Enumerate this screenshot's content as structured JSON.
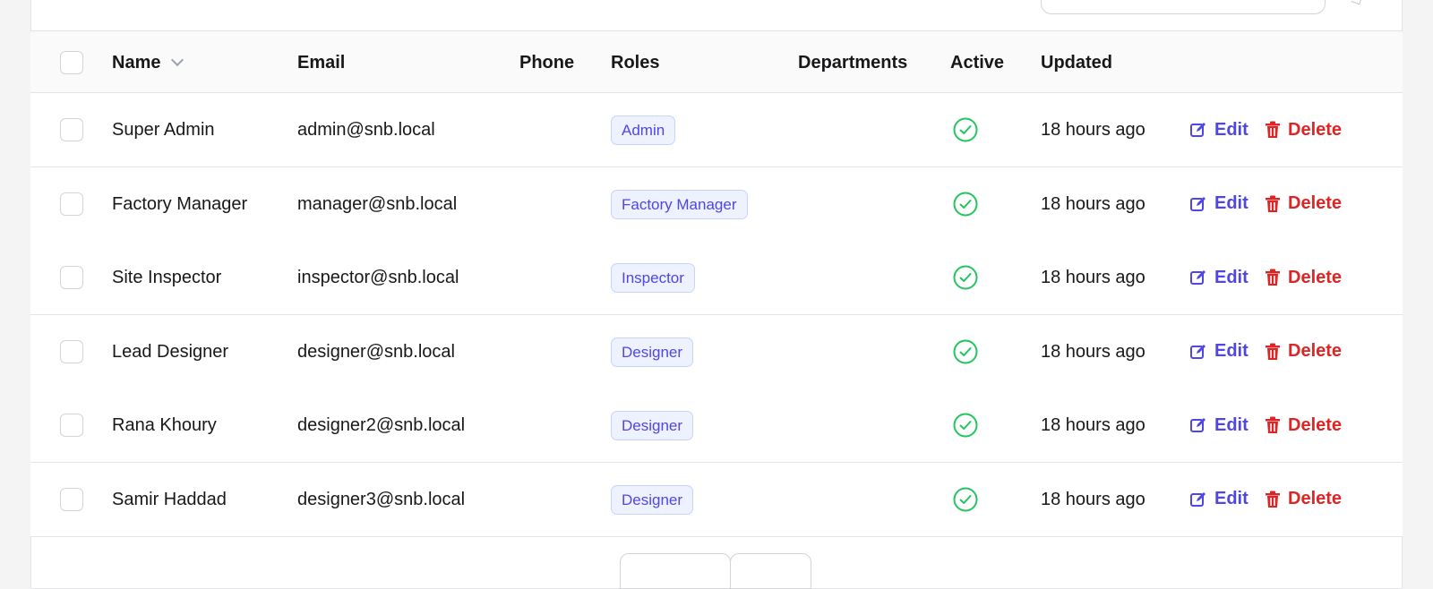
{
  "table": {
    "columns": {
      "name": "Name",
      "email": "Email",
      "phone": "Phone",
      "roles": "Roles",
      "departments": "Departments",
      "active": "Active",
      "updated": "Updated"
    },
    "actions": {
      "edit_label": "Edit",
      "delete_label": "Delete"
    },
    "rows": [
      {
        "name": "Super Admin",
        "email": "admin@snb.local",
        "phone": "",
        "role": "Admin",
        "active": true,
        "updated": "18 hours ago"
      },
      {
        "name": "Factory Manager",
        "email": "manager@snb.local",
        "phone": "",
        "role": "Factory Manager",
        "active": true,
        "updated": "18 hours ago"
      },
      {
        "name": "Site Inspector",
        "email": "inspector@snb.local",
        "phone": "",
        "role": "Inspector",
        "active": true,
        "updated": "18 hours ago"
      },
      {
        "name": "Lead Designer",
        "email": "designer@snb.local",
        "phone": "",
        "role": "Designer",
        "active": true,
        "updated": "18 hours ago"
      },
      {
        "name": "Rana Khoury",
        "email": "designer2@snb.local",
        "phone": "",
        "role": "Designer",
        "active": true,
        "updated": "18 hours ago"
      },
      {
        "name": "Samir Haddad",
        "email": "designer3@snb.local",
        "phone": "",
        "role": "Designer",
        "active": true,
        "updated": "18 hours ago"
      }
    ]
  },
  "colors": {
    "accent": "#4f46e5",
    "danger": "#dc2626",
    "success": "#22c55e",
    "badge_bg": "#eef2ff"
  },
  "icons": {
    "sort": "chevron-down-icon",
    "active": "check-circle-icon",
    "edit": "edit-icon",
    "delete": "trash-icon"
  }
}
